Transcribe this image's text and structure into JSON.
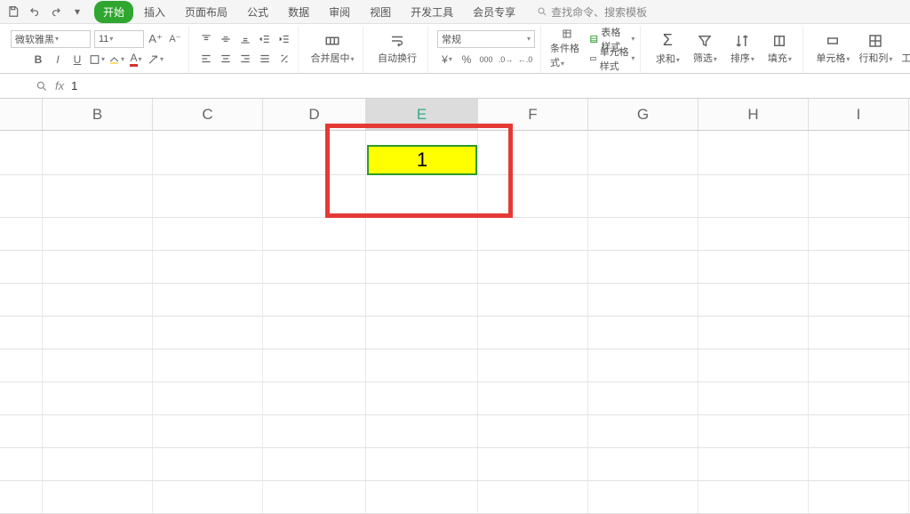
{
  "top": {
    "tabs": [
      "开始",
      "插入",
      "页面布局",
      "公式",
      "数据",
      "审阅",
      "视图",
      "开发工具",
      "会员专享"
    ],
    "search_placeholder": "查找命令、搜索模板"
  },
  "ribbon": {
    "font_name": "微软雅黑",
    "font_size": "11",
    "number_format": "常规",
    "merge_label": "合并居中",
    "wrap_label": "自动换行",
    "cond_label": "条件格式",
    "table_style_label": "表格样式",
    "cell_style_label": "单元格样式",
    "sum_label": "求和",
    "filter_label": "筛选",
    "sort_label": "排序",
    "fill_label": "填充",
    "cell_label": "单元格",
    "rowcol_label": "行和列",
    "sheet_label": "工作表"
  },
  "formula": {
    "value": "1"
  },
  "columns": [
    "B",
    "C",
    "D",
    "E",
    "F",
    "G",
    "H",
    "I"
  ],
  "widths": [
    "cw-b",
    "cw-c",
    "cw-d",
    "cw-e",
    "cw-f",
    "cw-g",
    "cw-h",
    "cw-i"
  ],
  "active_col": "E",
  "cell_value": "1"
}
